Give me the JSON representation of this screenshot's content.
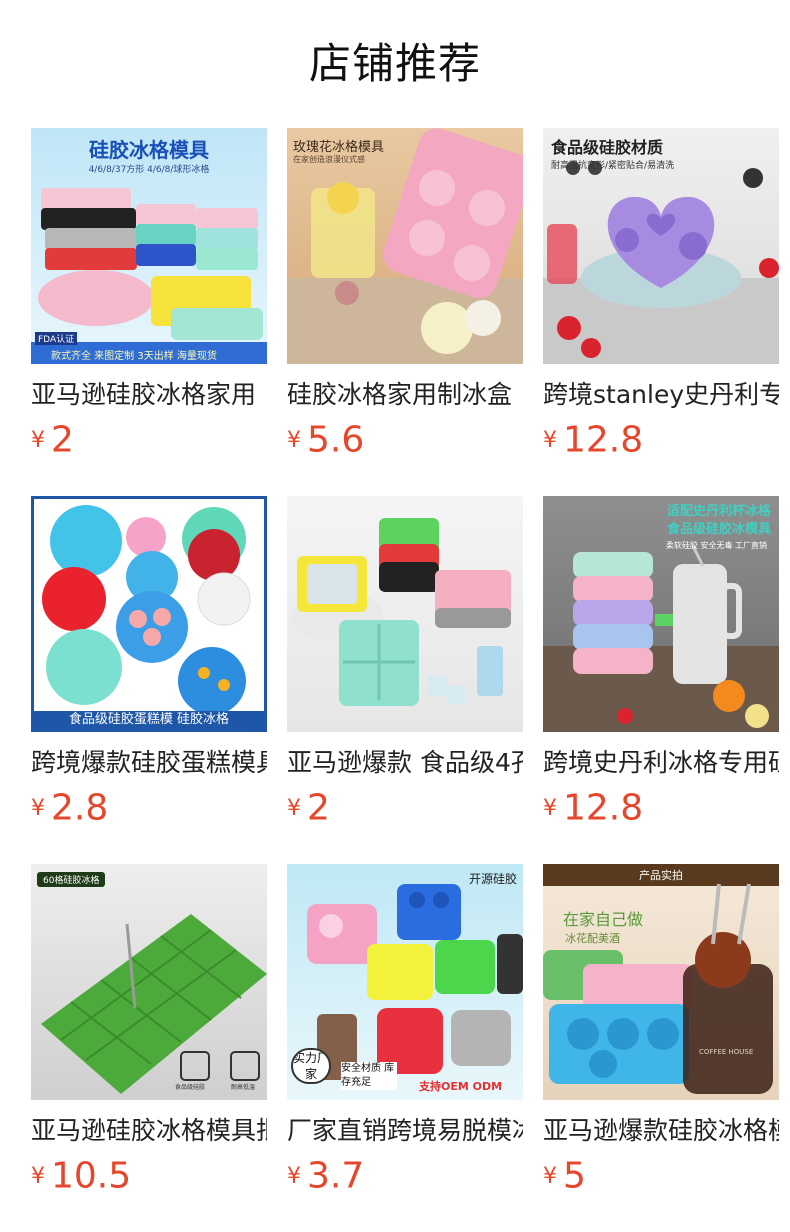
{
  "page": {
    "title": "店铺推荐"
  },
  "products": [
    {
      "name": "亚马逊硅胶冰格家用",
      "currency": "¥",
      "price": "2",
      "image_texts": [
        "硅胶冰格模具",
        "4/6/8/37方形 4/6/8/球形冰格",
        "FDA认证",
        "款式齐全 来图定制 3天出样 海量现货"
      ]
    },
    {
      "name": "硅胶冰格家用制冰盒",
      "currency": "¥",
      "price": "5.6",
      "image_texts": [
        "玫瑰花冰格模具",
        "在家创造浪漫仪式感"
      ]
    },
    {
      "name": "跨境stanley史丹利专",
      "currency": "¥",
      "price": "12.8",
      "image_texts": [
        "食品级硅胶材质",
        "耐高温抗变形/紧密贴合/易清洗"
      ]
    },
    {
      "name": "跨境爆款硅胶蛋糕模具",
      "currency": "¥",
      "price": "2.8",
      "image_texts": [
        "食品级硅胶蛋糕模 硅胶冰格"
      ]
    },
    {
      "name": "亚马逊爆款 食品级4孔",
      "currency": "¥",
      "price": "2",
      "image_texts": []
    },
    {
      "name": "跨境史丹利冰格专用硅",
      "currency": "¥",
      "price": "12.8",
      "image_texts": [
        "适配史丹利杯冰格",
        "食品级硅胶冰模具",
        "柔软硅胶 安全无毒 工厂直销"
      ]
    },
    {
      "name": "亚马逊硅胶冰格模具批",
      "currency": "¥",
      "price": "10.5",
      "image_texts": [
        "60格硅胶冰格",
        "食品级硅胶",
        "耐高低温"
      ]
    },
    {
      "name": "厂家直销跨境易脱模冰",
      "currency": "¥",
      "price": "3.7",
      "image_texts": [
        "开源硅胶",
        "实力厂家",
        "安全材质 库存充足",
        "支持OEM ODM"
      ]
    },
    {
      "name": "亚马逊爆款硅胶冰格模",
      "currency": "¥",
      "price": "5",
      "image_texts": [
        "产品实拍",
        "在家自己做",
        "冰花配美酒",
        "COFFEE HOUSE"
      ]
    }
  ],
  "colors": {
    "price": "#e4472b",
    "title": "#111111",
    "name": "#222222"
  }
}
